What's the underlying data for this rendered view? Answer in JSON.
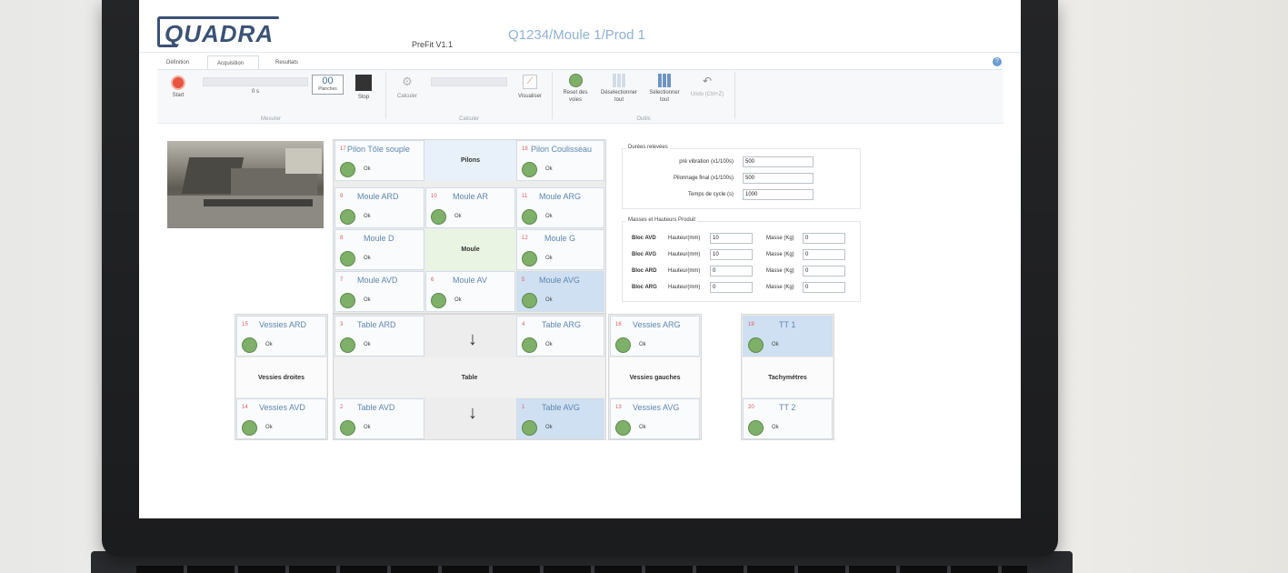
{
  "app": {
    "logo_text": "QUADRA",
    "version": "PreFit V1.1",
    "job_title": "Q1234/Moule 1/Prod 1",
    "help_glyph": "?"
  },
  "tabs": [
    {
      "label": "Définition",
      "active": false
    },
    {
      "label": "Acquisition",
      "active": true
    },
    {
      "label": "Resultats",
      "active": false
    }
  ],
  "ribbon": {
    "start_label": "Start",
    "progress_text": "0 s",
    "counter_value": "00",
    "counter_label": "Planches",
    "stop_label": "Stop",
    "calculer_label": "Calculer",
    "visualiser_label": "Visualiser",
    "reset_label": "Reset des voies",
    "deselect_label": "Déselectionner tout",
    "select_label": "Sélectionner tout",
    "undo_label": "Undo (Ctrl+Z)",
    "group_mesurer": "Mesurer",
    "group_calculer": "Calculer",
    "group_outils": "Outils",
    "colors": {
      "start": "#e8553e",
      "stop": "#333333",
      "reset": "#7fb069"
    }
  },
  "sensors": {
    "status_color": "#7fb069",
    "pilon_tole": {
      "num": "17",
      "label": "Pilon Tôle souple",
      "status": "Ok"
    },
    "pilon_coul": {
      "num": "18",
      "label": "Pilon Coulisseau",
      "status": "Ok"
    },
    "moule_ard": {
      "num": "9",
      "label": "Moule ARD",
      "status": "Ok"
    },
    "moule_ar": {
      "num": "10",
      "label": "Moule AR",
      "status": "Ok"
    },
    "moule_arg": {
      "num": "11",
      "label": "Moule ARG",
      "status": "Ok"
    },
    "moule_d": {
      "num": "8",
      "label": "Moule D",
      "status": "Ok"
    },
    "moule_g": {
      "num": "12",
      "label": "Moule G",
      "status": "Ok"
    },
    "moule_avd": {
      "num": "7",
      "label": "Moule AVD",
      "status": "Ok"
    },
    "moule_av": {
      "num": "6",
      "label": "Moule AV",
      "status": "Ok"
    },
    "moule_avg": {
      "num": "5",
      "label": "Moule AVG",
      "status": "Ok"
    },
    "vessies_ard": {
      "num": "15",
      "label": "Vessies ARD",
      "status": "Ok"
    },
    "vessies_avd": {
      "num": "14",
      "label": "Vessies AVD",
      "status": "Ok"
    },
    "table_ard": {
      "num": "3",
      "label": "Table ARD",
      "status": "Ok"
    },
    "table_arg": {
      "num": "4",
      "label": "Table ARG",
      "status": "Ok"
    },
    "table_avd": {
      "num": "2",
      "label": "Table AVD",
      "status": "Ok"
    },
    "table_avg": {
      "num": "1",
      "label": "Table AVG",
      "status": "Ok"
    },
    "vessies_arg": {
      "num": "16",
      "label": "Vessies ARG",
      "status": "Ok"
    },
    "vessies_avg": {
      "num": "13",
      "label": "Vessies AVG",
      "status": "Ok"
    },
    "tt1": {
      "num": "19",
      "label": "TT 1",
      "status": "Ok"
    },
    "tt2": {
      "num": "20",
      "label": "TT 2",
      "status": "Ok"
    }
  },
  "groups": {
    "pilons": "Pilons",
    "moule": "Moule",
    "table": "Table",
    "vessies_droites": "Vessies droites",
    "vessies_gauches": "Vessies gauches",
    "tachymetres": "Tachymétres",
    "arrow": "↓"
  },
  "durees": {
    "legend": "Durées relevées",
    "pre_vibration_label": "pré vibration (x1/100s)",
    "pre_vibration_value": "500",
    "pilonnage_label": "Pilonnage final (x1/100s)",
    "pilonnage_value": "500",
    "cycle_label": "Temps de cycle (s)",
    "cycle_value": "1000"
  },
  "masses": {
    "legend": "Masses et Hauteurs Produit",
    "hauteur_label": "Hauteur(mm)",
    "masse_label": "Masse (Kg)",
    "rows": [
      {
        "bloc": "Bloc AVD",
        "hauteur": "10",
        "masse": "0"
      },
      {
        "bloc": "Bloc AVG",
        "hauteur": "10",
        "masse": "0"
      },
      {
        "bloc": "Bloc ARD",
        "hauteur": "0",
        "masse": "0"
      },
      {
        "bloc": "Bloc ARG",
        "hauteur": "0",
        "masse": "0"
      }
    ]
  }
}
